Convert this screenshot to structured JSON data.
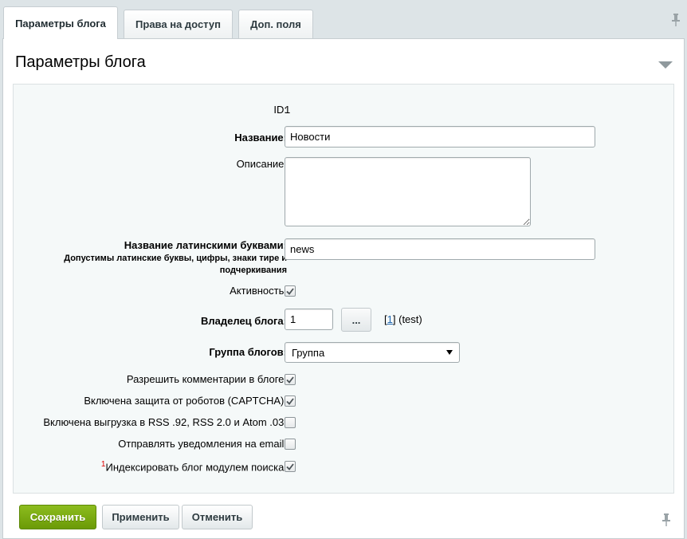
{
  "tabs": [
    {
      "label": "Параметры блога",
      "active": true
    },
    {
      "label": "Права на доступ",
      "active": false
    },
    {
      "label": "Доп. поля",
      "active": false
    }
  ],
  "section": {
    "title": "Параметры блога"
  },
  "form": {
    "id": {
      "label": "ID:",
      "value": "1"
    },
    "name": {
      "label": "Название:",
      "value": "Новости"
    },
    "description": {
      "label": "Описание:",
      "value": ""
    },
    "latin_name": {
      "label": "Название латинскими буквами:",
      "hint": "Допустимы латинские буквы, цифры, знаки тире и подчеркивания",
      "value": "news"
    },
    "active": {
      "label": "Активность:",
      "checked": true
    },
    "owner": {
      "label": "Владелец блога:",
      "value": "1",
      "browse_label": "...",
      "link_text": "1",
      "bracket_open": "[",
      "bracket_close": "]",
      "user_text": "(test)"
    },
    "group": {
      "label": "Группа блогов:",
      "selected": "Группа"
    },
    "allow_comments": {
      "label": "Разрешить комментарии в блоге:",
      "checked": true
    },
    "captcha": {
      "label": "Включена защита от роботов (CAPTCHA):",
      "checked": true
    },
    "rss": {
      "label": "Включена выгрузка в RSS .92, RSS 2.0 и Atom .03:",
      "checked": false
    },
    "email_notify": {
      "label": "Отправлять уведомления на email:",
      "checked": false
    },
    "search_index": {
      "label": "Индексировать блог модулем поиска:",
      "footnote": "1",
      "checked": true
    }
  },
  "buttons": {
    "save": "Сохранить",
    "apply": "Применить",
    "cancel": "Отменить"
  },
  "colors": {
    "accent_green": "#7aab12",
    "link": "#2067b0",
    "background": "#dde4e7"
  }
}
